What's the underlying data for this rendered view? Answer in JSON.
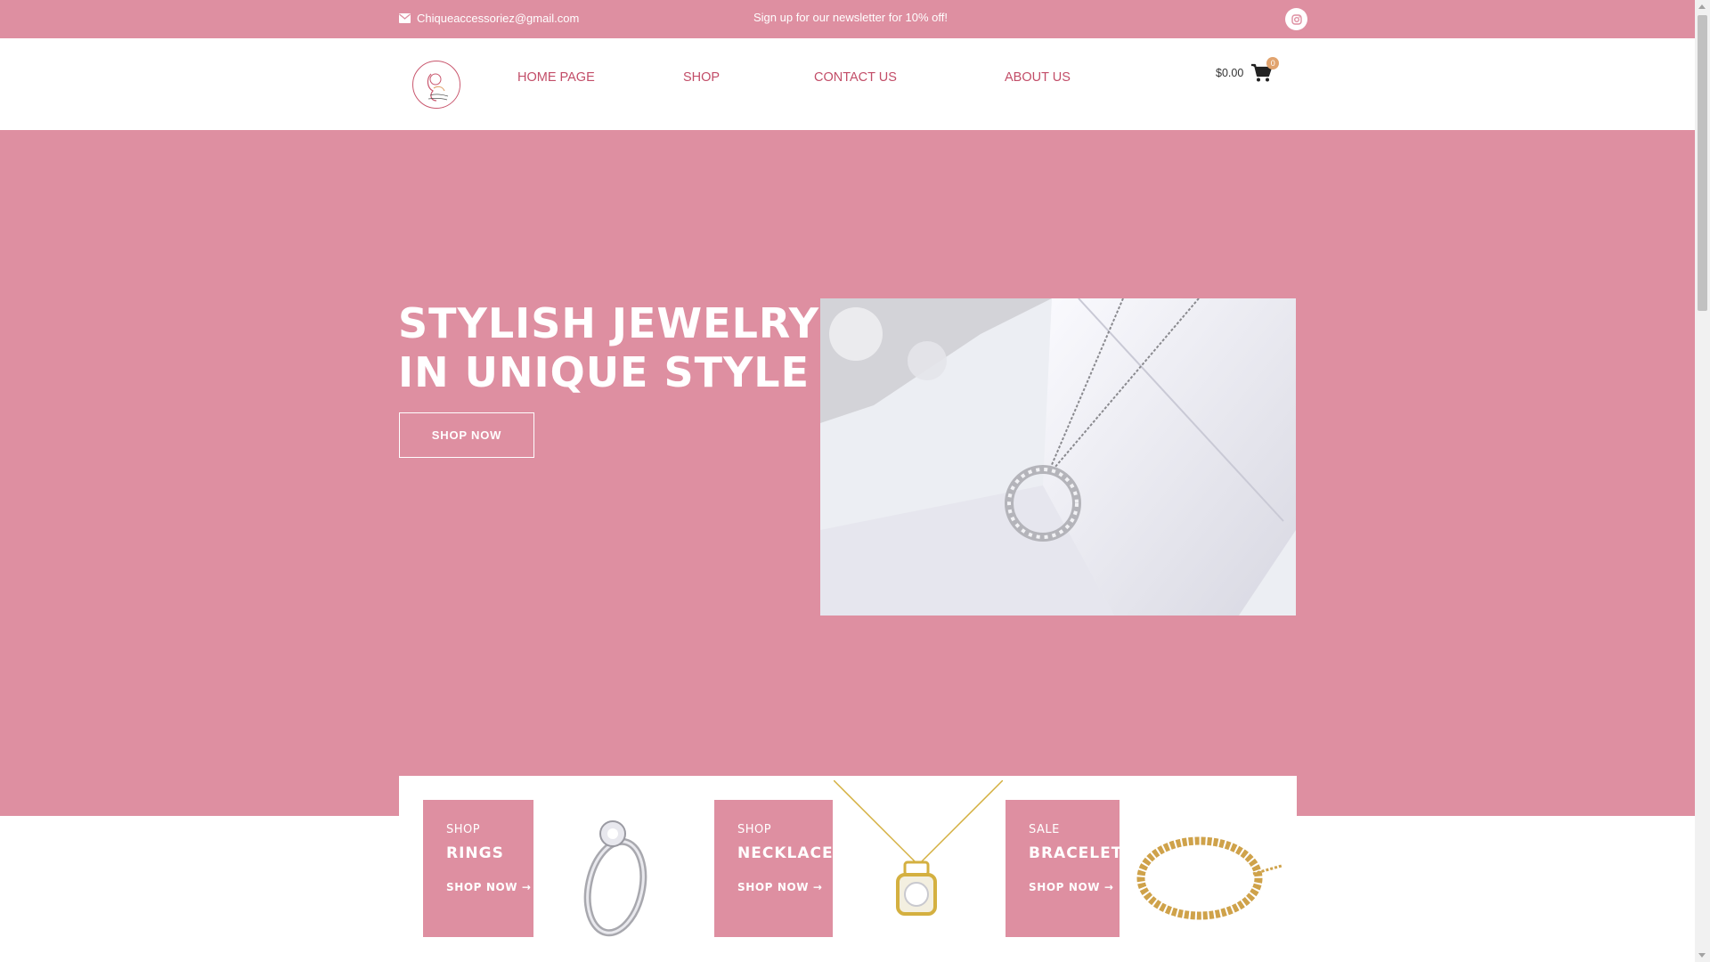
{
  "topbar": {
    "email": "Chiqueaccessoriez@gmail.com",
    "promo": "Sign up for our newsletter for 10% off!"
  },
  "nav": {
    "items": [
      {
        "label": "HOME PAGE"
      },
      {
        "label": "SHOP"
      },
      {
        "label": "CONTACT US"
      },
      {
        "label": "ABOUT US"
      }
    ],
    "cart_amount": "$0.00",
    "cart_count": "0"
  },
  "hero": {
    "title_line1": "STYLISH JEWELRY",
    "title_line2": "IN UNIQUE STYLE",
    "button": "SHOP NOW"
  },
  "categories": [
    {
      "small": "SHOP",
      "big": "RINGS",
      "link": "SHOP NOW"
    },
    {
      "small": "SHOP",
      "big": "NECKLACES",
      "link": "SHOP NOW"
    },
    {
      "small": "SALE",
      "big": "BRACELETS",
      "link": "SHOP NOW"
    }
  ],
  "colors": {
    "brand_pink": "#de8fa1",
    "nav_text": "#c24d68",
    "cart_badge": "#e1a36e"
  },
  "icons": [
    "envelope-icon",
    "instagram-icon",
    "cart-icon",
    "arrow-right-icon"
  ]
}
